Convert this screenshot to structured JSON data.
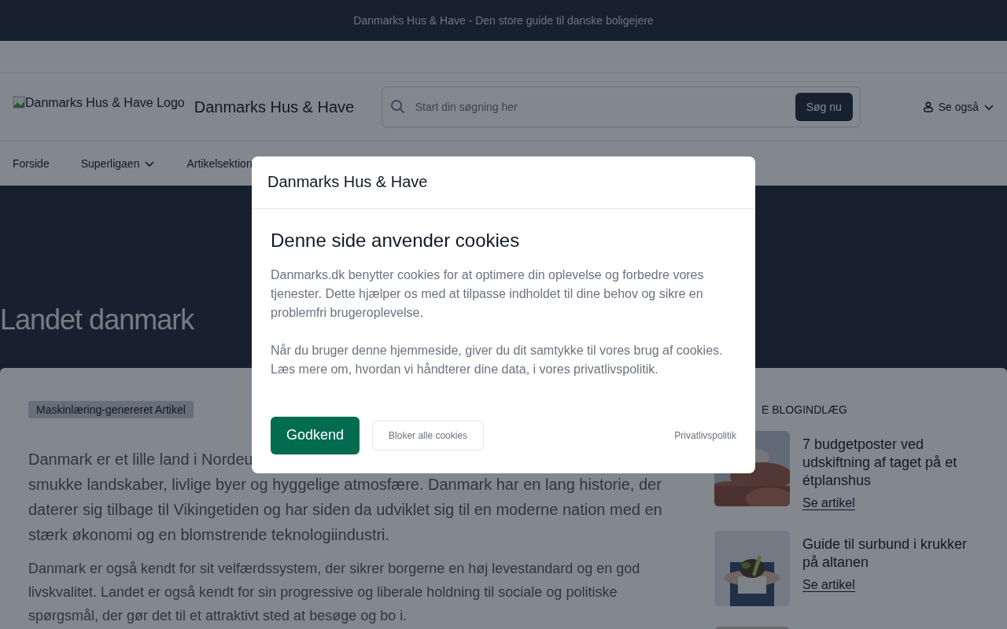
{
  "top_banner": {
    "text": "Danmarks Hus & Have - Den store guide til danske boligejere"
  },
  "header": {
    "logo_alt": "Danmarks Hus & Have Logo",
    "site_name": "Danmarks Hus & Have",
    "search": {
      "placeholder": "Start din søgning her",
      "button": "Søg nu"
    },
    "account_menu": {
      "label": "Se også"
    }
  },
  "nav": {
    "items": [
      {
        "label": "Forside",
        "has_submenu": false
      },
      {
        "label": "Superligaen",
        "has_submenu": true
      },
      {
        "label": "Artikelsektion",
        "has_submenu": false
      }
    ]
  },
  "hero": {
    "title": "Landet danmark"
  },
  "article": {
    "badge": "Maskinlæring-genereret Artikel",
    "paragraphs": [
      {
        "kind": "lead",
        "lines": [
          "Danmark er et lille land i Nordeu",
          "smukke landskaber, livlige byer og hyggelige atmosfære. Danmark har en lang historie, der",
          "daterer sig tilbage til Vikingetiden og har siden da udviklet sig til en moderne nation med en",
          "stærk økonomi og en blomstrende teknologiindustri."
        ]
      },
      {
        "kind": "body",
        "lines": [
          "Danmark er også kendt for sit velfærdssystem, der sikrer borgerne en høj levestandard og en god",
          "livskvalitet. Landet er også kendt for sin progressive og liberale holdning til sociale og politiske",
          "spørgsmål, der gør det til et attraktivt sted at besøge og bo i."
        ]
      }
    ]
  },
  "sidebar": {
    "heading": "E BLOGINDLÆG",
    "posts": [
      {
        "title": "7 budgetposter ved udskiftning af taget på et étplanshus",
        "link": "Se artikel"
      },
      {
        "title": "Guide til surbund i krukker på altanen",
        "link": "Se artikel"
      },
      {
        "kind": "picture"
      }
    ]
  },
  "cookie_dialog": {
    "title": "Danmarks Hus & Have",
    "heading": "Denne side anvender cookies",
    "paragraphs": [
      "Danmarks.dk benytter cookies for at optimere din oplevelse og forbedre vores tjenester. Dette hjælper os med at tilpasse indholdet til dine behov og sikre en problemfri brugeroplevelse.",
      "Når du bruger denne hjemmeside, giver du dit samtykke til vores brug af cookies. Læs mere om, hvordan vi håndterer dine data, i vores privatlivspolitik."
    ],
    "accept": "Godkend",
    "reject": "Bloker alle cookies",
    "policy_link": "Privatlivspolitik"
  }
}
